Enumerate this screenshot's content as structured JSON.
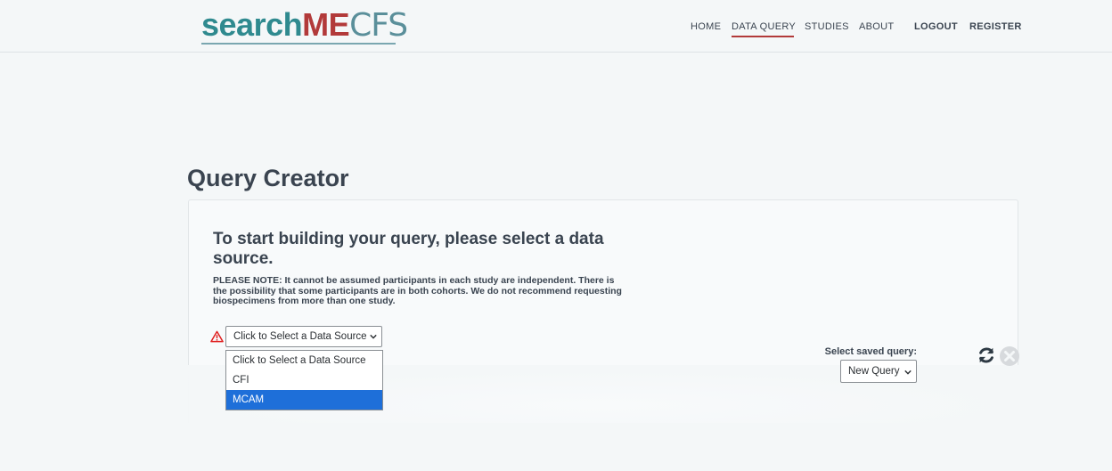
{
  "brand": {
    "part1": "search",
    "part2": "ME",
    "part3": "CFS"
  },
  "nav": {
    "items": [
      {
        "label": "HOME"
      },
      {
        "label": "DATA QUERY"
      },
      {
        "label": "STUDIES"
      },
      {
        "label": "ABOUT"
      }
    ],
    "active": "DATA QUERY",
    "logout": "LOGOUT",
    "register": "REGISTER"
  },
  "page": {
    "title": "Query Creator"
  },
  "card": {
    "heading": "To start building your query, please select a data source.",
    "note": "PLEASE NOTE: It cannot be assumed participants in each study are independent. There is the possibility that some participants are in both cohorts. We do not recommend requesting biospecimens from more than one study."
  },
  "data_source": {
    "selected": "Click to Select a Data Source",
    "options": [
      "Click to Select a Data Source",
      "CFI",
      "MCAM"
    ],
    "highlighted": "MCAM"
  },
  "saved_query": {
    "label": "Select saved query:",
    "selected": "New Query"
  },
  "icons": {
    "warning": "warning-triangle-icon",
    "refresh": "refresh-icon",
    "close": "close-icon"
  },
  "colors": {
    "brand_teal": "#2f8a8f",
    "brand_red": "#b23a3a",
    "highlight": "#1e6fd9",
    "warning": "#e02020"
  }
}
